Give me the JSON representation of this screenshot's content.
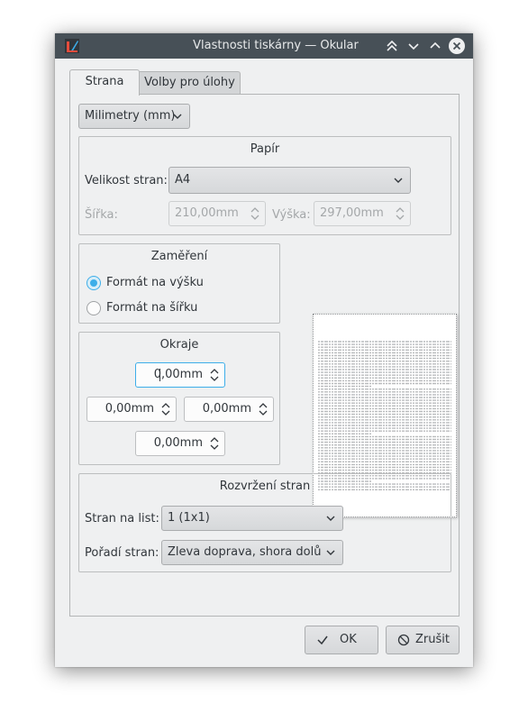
{
  "window": {
    "title": "Vlastnosti tiskárny — Okular"
  },
  "tabs": [
    {
      "label": "Strana"
    },
    {
      "label": "Volby pro úlohy"
    }
  ],
  "units": {
    "selected": "Milimetry (mm)"
  },
  "paper": {
    "title": "Papír",
    "size_label": "Velikost stran:",
    "size_value": "A4",
    "width_label": "Šířka:",
    "width_value": "210,00mm",
    "height_label": "Výška:",
    "height_value": "297,00mm"
  },
  "orientation": {
    "title": "Zaměření",
    "portrait_label": "Formát na výšku",
    "landscape_label": "Formát na šířku",
    "selected": "portrait"
  },
  "margins": {
    "title": "Okraje",
    "top_value": "0,00mm",
    "left_value": "0,00mm",
    "right_value": "0,00mm",
    "bottom_value": "0,00mm"
  },
  "layout": {
    "title": "Rozvržení stran",
    "pages_per_sheet_label": "Stran na list:",
    "pages_per_sheet_value": "1 (1x1)",
    "page_order_label": "Pořadí stran:",
    "page_order_value": "Zleva doprava, shora dolů"
  },
  "buttons": {
    "ok_label": "OK",
    "cancel_label": "Zrušit"
  },
  "colors": {
    "titlebar": "#475057",
    "accent": "#3daee9",
    "window_bg": "#eff0f1"
  }
}
